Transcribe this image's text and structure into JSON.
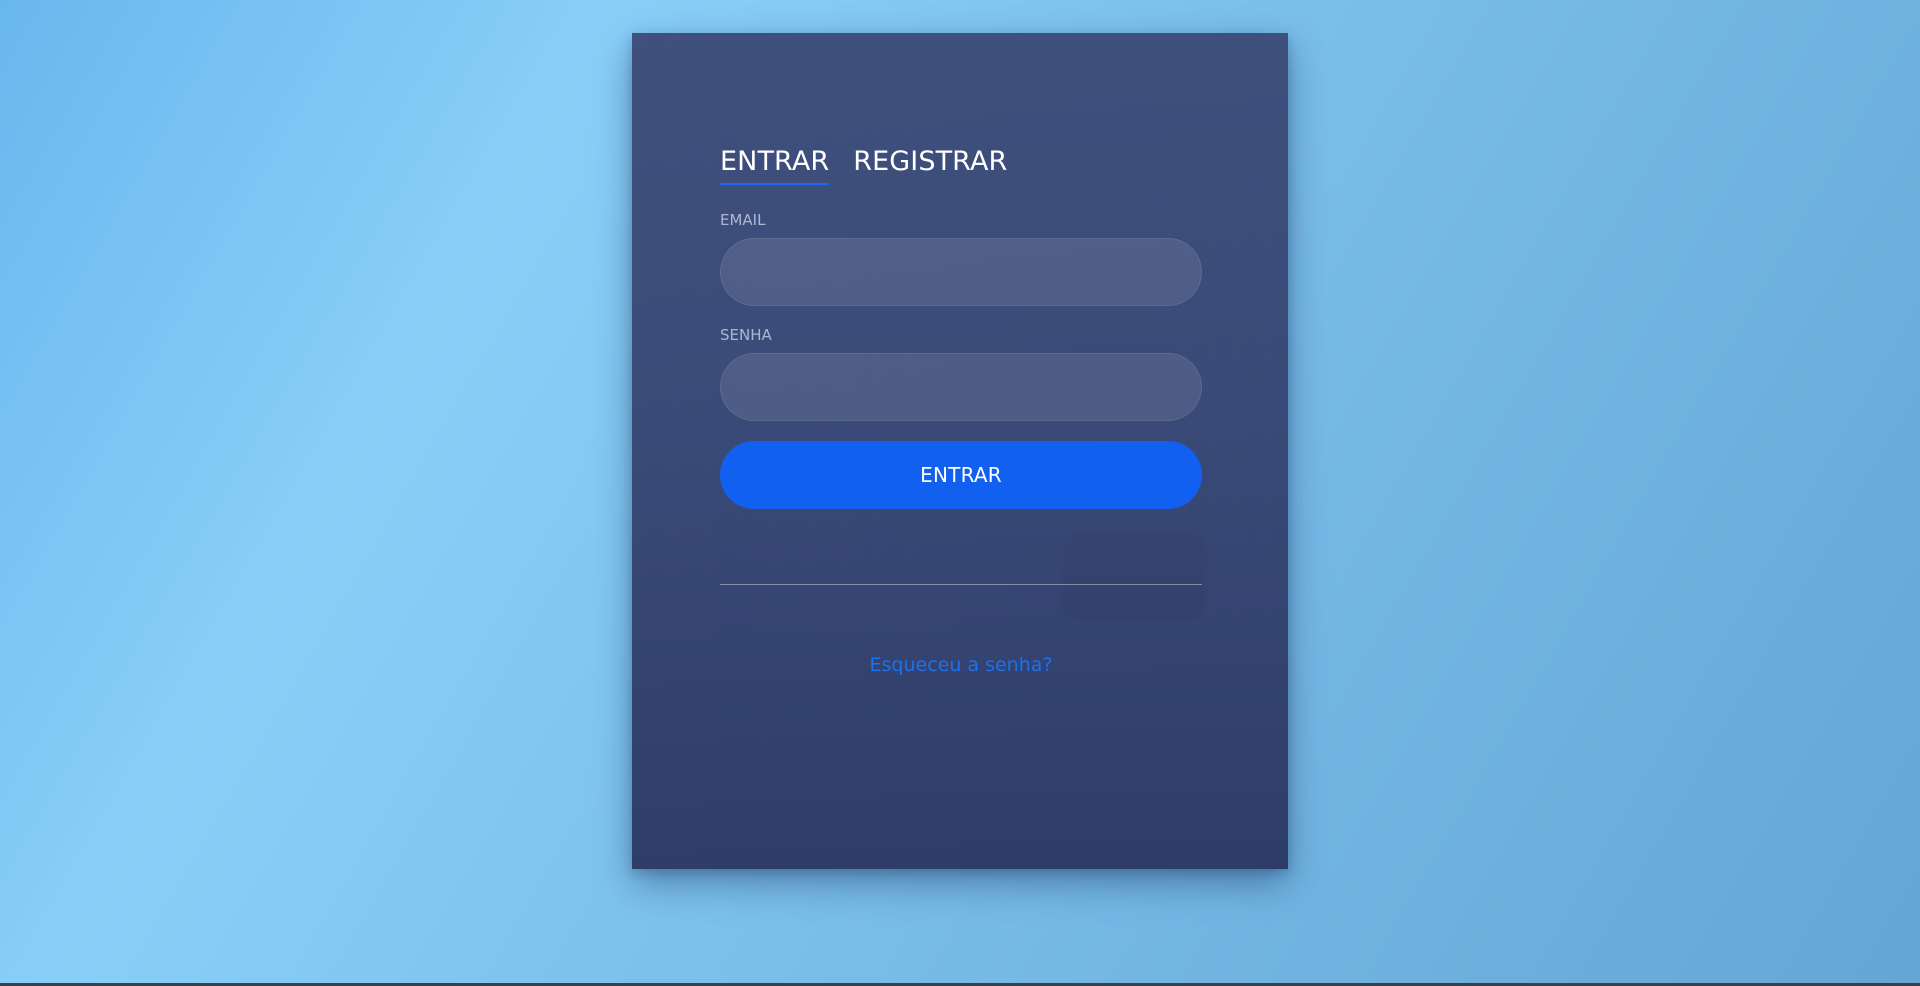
{
  "login": {
    "tabs": [
      {
        "label": "ENTRAR"
      },
      {
        "label": "REGISTRAR"
      }
    ],
    "email_label": "EMAIL",
    "password_label": "SENHA",
    "submit_label": "ENTRAR",
    "forgot_link": "Esqueceu a senha?"
  },
  "colors": {
    "accent": "#1160ef",
    "link": "#1b71ef"
  }
}
